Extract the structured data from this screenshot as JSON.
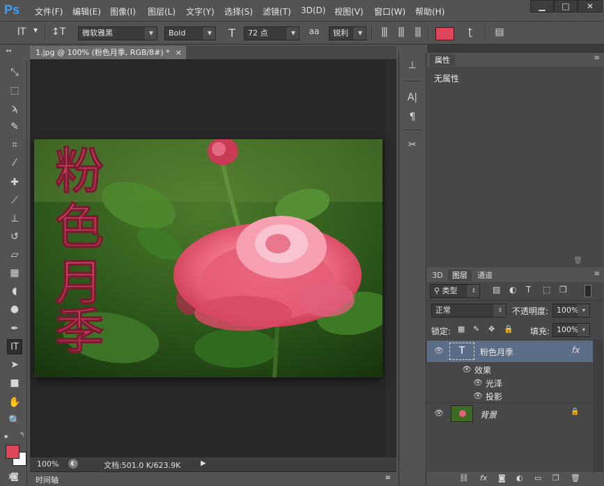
{
  "app": {
    "logo": "Ps"
  },
  "menu": [
    "文件(F)",
    "编辑(E)",
    "图像(I)",
    "图层(L)",
    "文字(Y)",
    "选择(S)",
    "滤镜(T)",
    "3D(D)",
    "视图(V)",
    "窗口(W)",
    "帮助(H)"
  ],
  "window_buttons": {
    "minimize": "▁",
    "maximize": "□",
    "close": "✕"
  },
  "options": {
    "tool_icon": "IT",
    "orient_icon": "↕T",
    "font_family": "微软雅黑",
    "font_style": "Bold",
    "size_icon": "T",
    "font_size": "72 点",
    "aa_icon": "aa",
    "anti_alias": "锐利",
    "text_color": "#e0465a"
  },
  "document": {
    "tab_title": "1.jpg @ 100% (粉色月季, RGB/8#) *",
    "tab_close": "×",
    "overlay_text": [
      "粉",
      "色",
      "月",
      "季"
    ],
    "zoom": "100%",
    "doc_info": "文档:501.0 K/623.9K",
    "play": "▶"
  },
  "timeline": {
    "label": "时间轴"
  },
  "properties": {
    "tab": "属性",
    "empty_text": "无属性"
  },
  "layers_panel": {
    "tabs": [
      "3D",
      "图层",
      "通道"
    ],
    "filter_kind": "类型",
    "blend_mode": "正常",
    "opacity_label": "不透明度:",
    "opacity": "100%",
    "lock_label": "锁定:",
    "fill_label": "填充:",
    "fill": "100%",
    "layers": [
      {
        "name": "粉色月季",
        "kind": "text",
        "fx": "fx"
      },
      {
        "name": "背景",
        "kind": "image"
      }
    ],
    "effects_label": "效果",
    "effects": [
      "光泽",
      "投影"
    ]
  },
  "colors": {
    "foreground": "#e0465a",
    "background": "#ffffff",
    "accent": "#3aa0ff"
  }
}
